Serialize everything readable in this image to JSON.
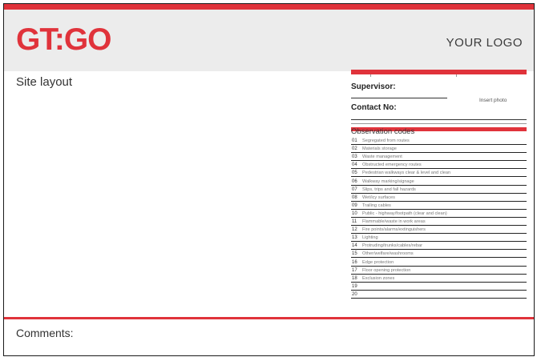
{
  "header": {
    "brand": "GT:GO",
    "logo_placeholder": "YOUR LOGO"
  },
  "main": {
    "site_layout_label": "Site layout"
  },
  "sidebar": {
    "supervisor_label": "Supervisor:",
    "contact_label": "Contact No:",
    "insert_photo_label": "Insert photo"
  },
  "observation": {
    "title": "Observation codes",
    "items": [
      {
        "num": "01",
        "text": "Segregated from routes"
      },
      {
        "num": "02",
        "text": "Materials storage"
      },
      {
        "num": "03",
        "text": "Waste management"
      },
      {
        "num": "04",
        "text": "Obstructed emergency routes"
      },
      {
        "num": "05",
        "text": "Pedestrian walkways clear & level and clean"
      },
      {
        "num": "06",
        "text": "Walkway marking/signage"
      },
      {
        "num": "07",
        "text": "Slips, trips and fall hazards"
      },
      {
        "num": "08",
        "text": "Wet/icy surfaces"
      },
      {
        "num": "09",
        "text": "Trailing cables"
      },
      {
        "num": "10",
        "text": "Public - highway/footpath (clear and clean)"
      },
      {
        "num": "11",
        "text": "Flammable/waste in work areas"
      },
      {
        "num": "12",
        "text": "Fire points/alarms/extinguishers"
      },
      {
        "num": "13",
        "text": "Lighting"
      },
      {
        "num": "14",
        "text": "Protruding/trunks/cables/rebar"
      },
      {
        "num": "15",
        "text": "Other/welfare/washrooms"
      },
      {
        "num": "16",
        "text": "Edge protection"
      },
      {
        "num": "17",
        "text": "Floor opening protection"
      },
      {
        "num": "18",
        "text": "Exclusion zones"
      },
      {
        "num": "19",
        "text": ""
      },
      {
        "num": "20",
        "text": ""
      }
    ]
  },
  "footer": {
    "comments_label": "Comments:"
  },
  "colors": {
    "accent": "#e0333b",
    "header_bg": "#ececec"
  }
}
